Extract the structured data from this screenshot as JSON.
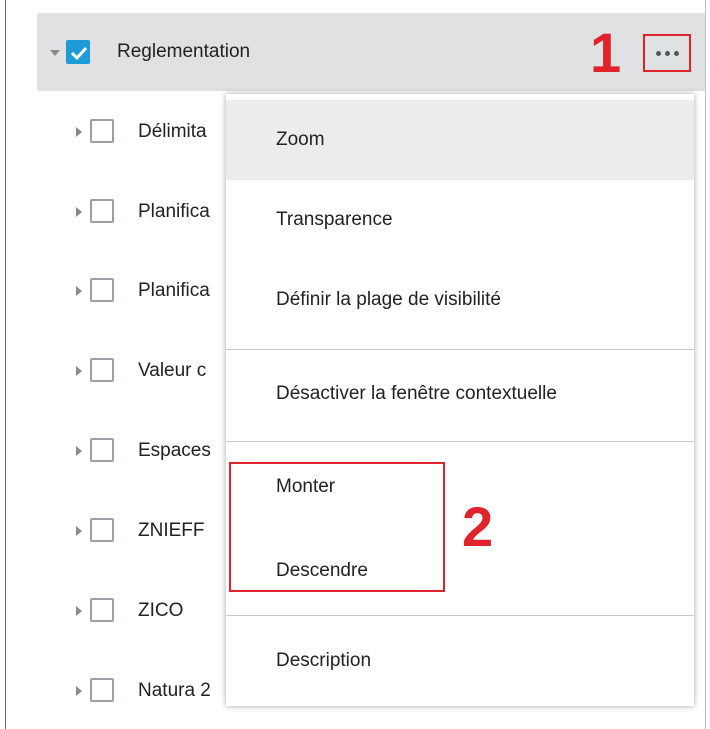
{
  "tree": {
    "group": {
      "label": "Reglementation",
      "checked": true,
      "expanded": true
    },
    "children": [
      {
        "label": "Délimita",
        "checked": false
      },
      {
        "label": "Planifica",
        "checked": false
      },
      {
        "label": "Planifica",
        "checked": false
      },
      {
        "label": "Valeur c",
        "checked": false
      },
      {
        "label": "Espaces",
        "checked": false
      },
      {
        "label": "ZNIEFF",
        "checked": false
      },
      {
        "label": "ZICO",
        "checked": false
      },
      {
        "label": "Natura 2",
        "checked": false
      }
    ]
  },
  "menu": {
    "items": [
      {
        "label": "Zoom"
      },
      {
        "label": "Transparence"
      },
      {
        "label": "Définir la plage de visibilité"
      },
      {
        "label": "Désactiver la fenêtre contextuelle"
      },
      {
        "label": "Monter"
      },
      {
        "label": "Descendre"
      },
      {
        "label": "Description"
      }
    ]
  },
  "annotations": {
    "first": "1",
    "second": "2"
  },
  "colors": {
    "accent": "#1e9bd7",
    "annotation": "#e0232a",
    "header_bg": "#dfe1e2"
  }
}
